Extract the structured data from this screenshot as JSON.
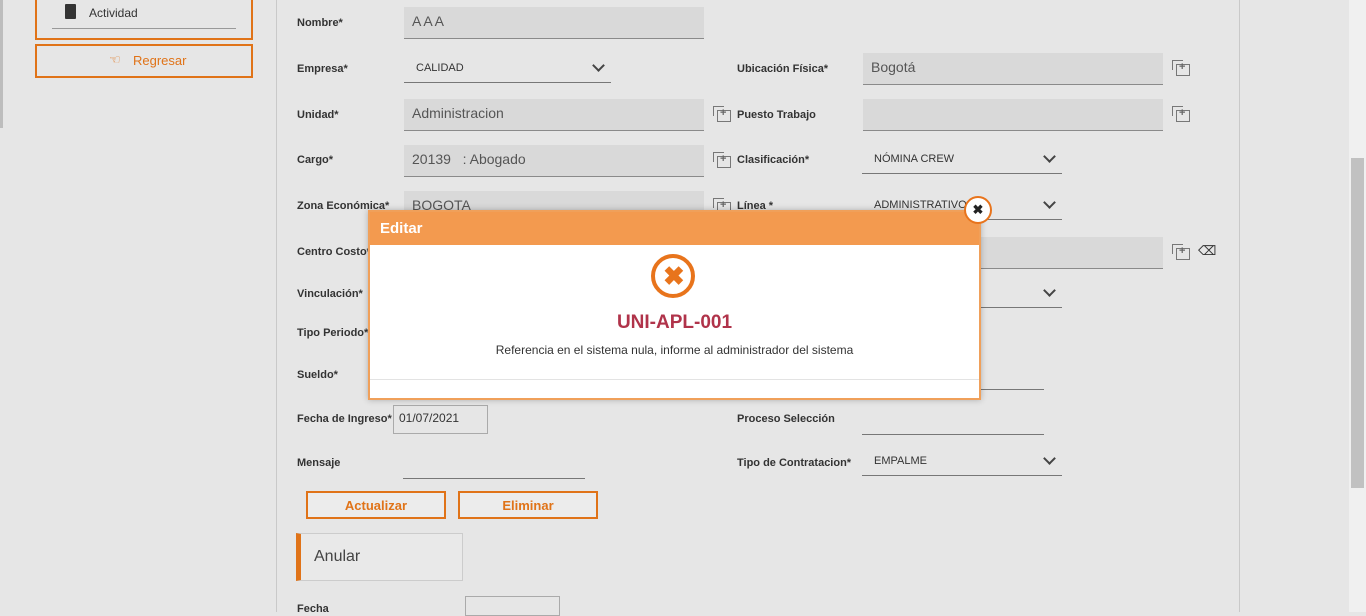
{
  "sidebar": {
    "actividad": "Actividad",
    "regresar": "Regresar"
  },
  "form": {
    "nombre": {
      "label": "Nombre*",
      "value": "AAA"
    },
    "empresa": {
      "label": "Empresa*",
      "value": "CALIDAD"
    },
    "ubicacion": {
      "label": "Ubicación Física*",
      "value": "Bogotá"
    },
    "unidad": {
      "label": "Unidad*",
      "value": "Administracion"
    },
    "puesto": {
      "label": "Puesto Trabajo",
      "value": ""
    },
    "cargo": {
      "label": "Cargo*",
      "value": "20139   : Abogado"
    },
    "clasificacion": {
      "label": "Clasificación*",
      "value": "NÓMINA CREW"
    },
    "zona": {
      "label": "Zona Económica*",
      "value": "BOGOTA"
    },
    "linea": {
      "label": "Línea *",
      "value": "ADMINISTRATIVO"
    },
    "centro": {
      "label": "Centro Costo*"
    },
    "vinculacion": {
      "label": "Vinculación*"
    },
    "tipo_periodo": {
      "label": "Tipo Periodo*"
    },
    "sueldo": {
      "label": "Sueldo*"
    },
    "fecha_ingreso": {
      "label": "Fecha de Ingreso*",
      "value": "01/07/2021"
    },
    "proceso": {
      "label": "Proceso Selección"
    },
    "mensaje": {
      "label": "Mensaje"
    },
    "tipo_contratacion": {
      "label": "Tipo de Contratacion*",
      "value": "EMPALME"
    },
    "fecha": {
      "label": "Fecha"
    }
  },
  "buttons": {
    "actualizar": "Actualizar",
    "eliminar": "Eliminar"
  },
  "anular": {
    "title": "Anular"
  },
  "modal": {
    "title": "Editar",
    "code": "UNI-APL-001",
    "message": "Referencia en el sistema nula, informe al administrador del sistema"
  }
}
